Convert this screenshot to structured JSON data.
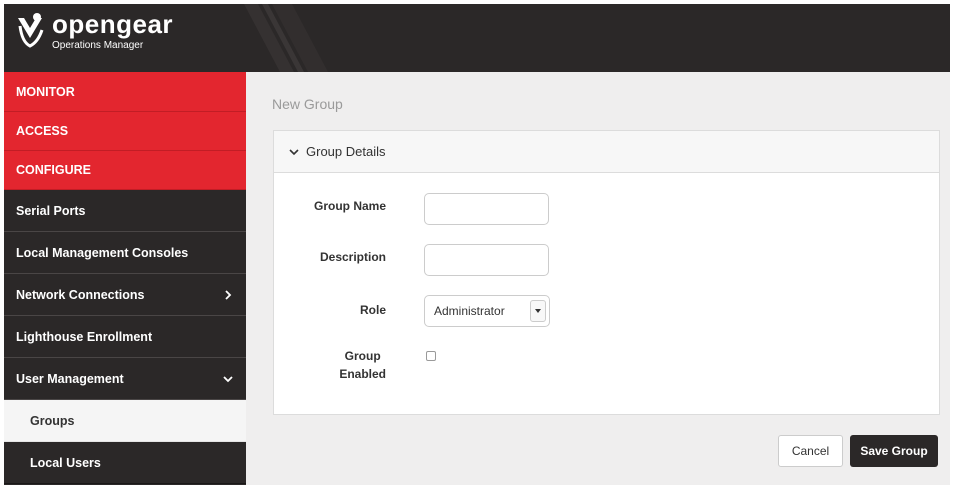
{
  "header": {
    "brand": "opengear",
    "subtitle": "Operations Manager"
  },
  "sidebar": {
    "items": [
      {
        "label": "MONITOR"
      },
      {
        "label": "ACCESS"
      },
      {
        "label": "CONFIGURE"
      },
      {
        "label": "Serial Ports"
      },
      {
        "label": "Local Management Consoles"
      },
      {
        "label": "Network Connections",
        "icon": "chevron-right-icon"
      },
      {
        "label": "Lighthouse Enrollment"
      },
      {
        "label": "User Management",
        "icon": "chevron-down-icon"
      },
      {
        "label": "Groups"
      },
      {
        "label": "Local Users"
      }
    ]
  },
  "main": {
    "title": "New Group",
    "panel": {
      "title": "Group Details",
      "icon": "chevron-down-icon",
      "fields": {
        "group_name": {
          "label": "Group Name",
          "value": ""
        },
        "description": {
          "label": "Description",
          "value": ""
        },
        "role": {
          "label": "Role",
          "value": "Administrator"
        },
        "enabled": {
          "label_line1": "Group",
          "label_line2": "Enabled",
          "checked": false
        }
      }
    },
    "buttons": {
      "cancel": "Cancel",
      "save": "Save Group"
    }
  },
  "colors": {
    "accent_red": "#e3262f",
    "dark": "#2b2828",
    "content_bg": "#efeeee"
  }
}
